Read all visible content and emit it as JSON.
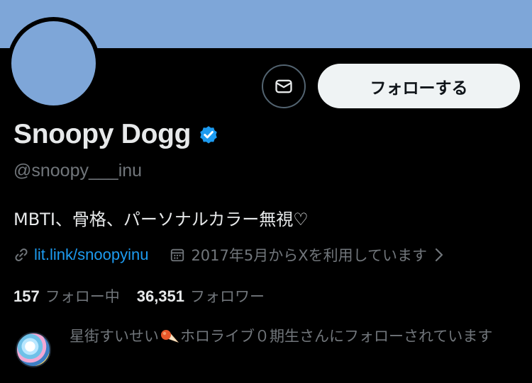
{
  "profile": {
    "display_name": "Snoopy Dogg",
    "handle": "@snoopy___inu",
    "bio": "MBTI、骨格、パーソナルカラー無視♡",
    "link": "lit.link/snoopyinu",
    "joined": "2017年5月からXを利用しています",
    "following_count": "157",
    "following_label": "フォロー中",
    "followers_count": "36,351",
    "followers_label": "フォロワー"
  },
  "actions": {
    "follow_label": "フォローする"
  },
  "mutual": {
    "text_before": "星街すいせい",
    "text_after": "ホロライブ０期生さんにフォローされています"
  },
  "colors": {
    "banner": "#7ea6d8",
    "accent": "#1d9bf0",
    "secondary_text": "#71767b",
    "background": "#000000"
  },
  "icons": {
    "message": "envelope-icon",
    "verified": "verified-badge-icon",
    "link": "link-icon",
    "calendar": "calendar-icon",
    "chevron": "chevron-right-icon"
  }
}
